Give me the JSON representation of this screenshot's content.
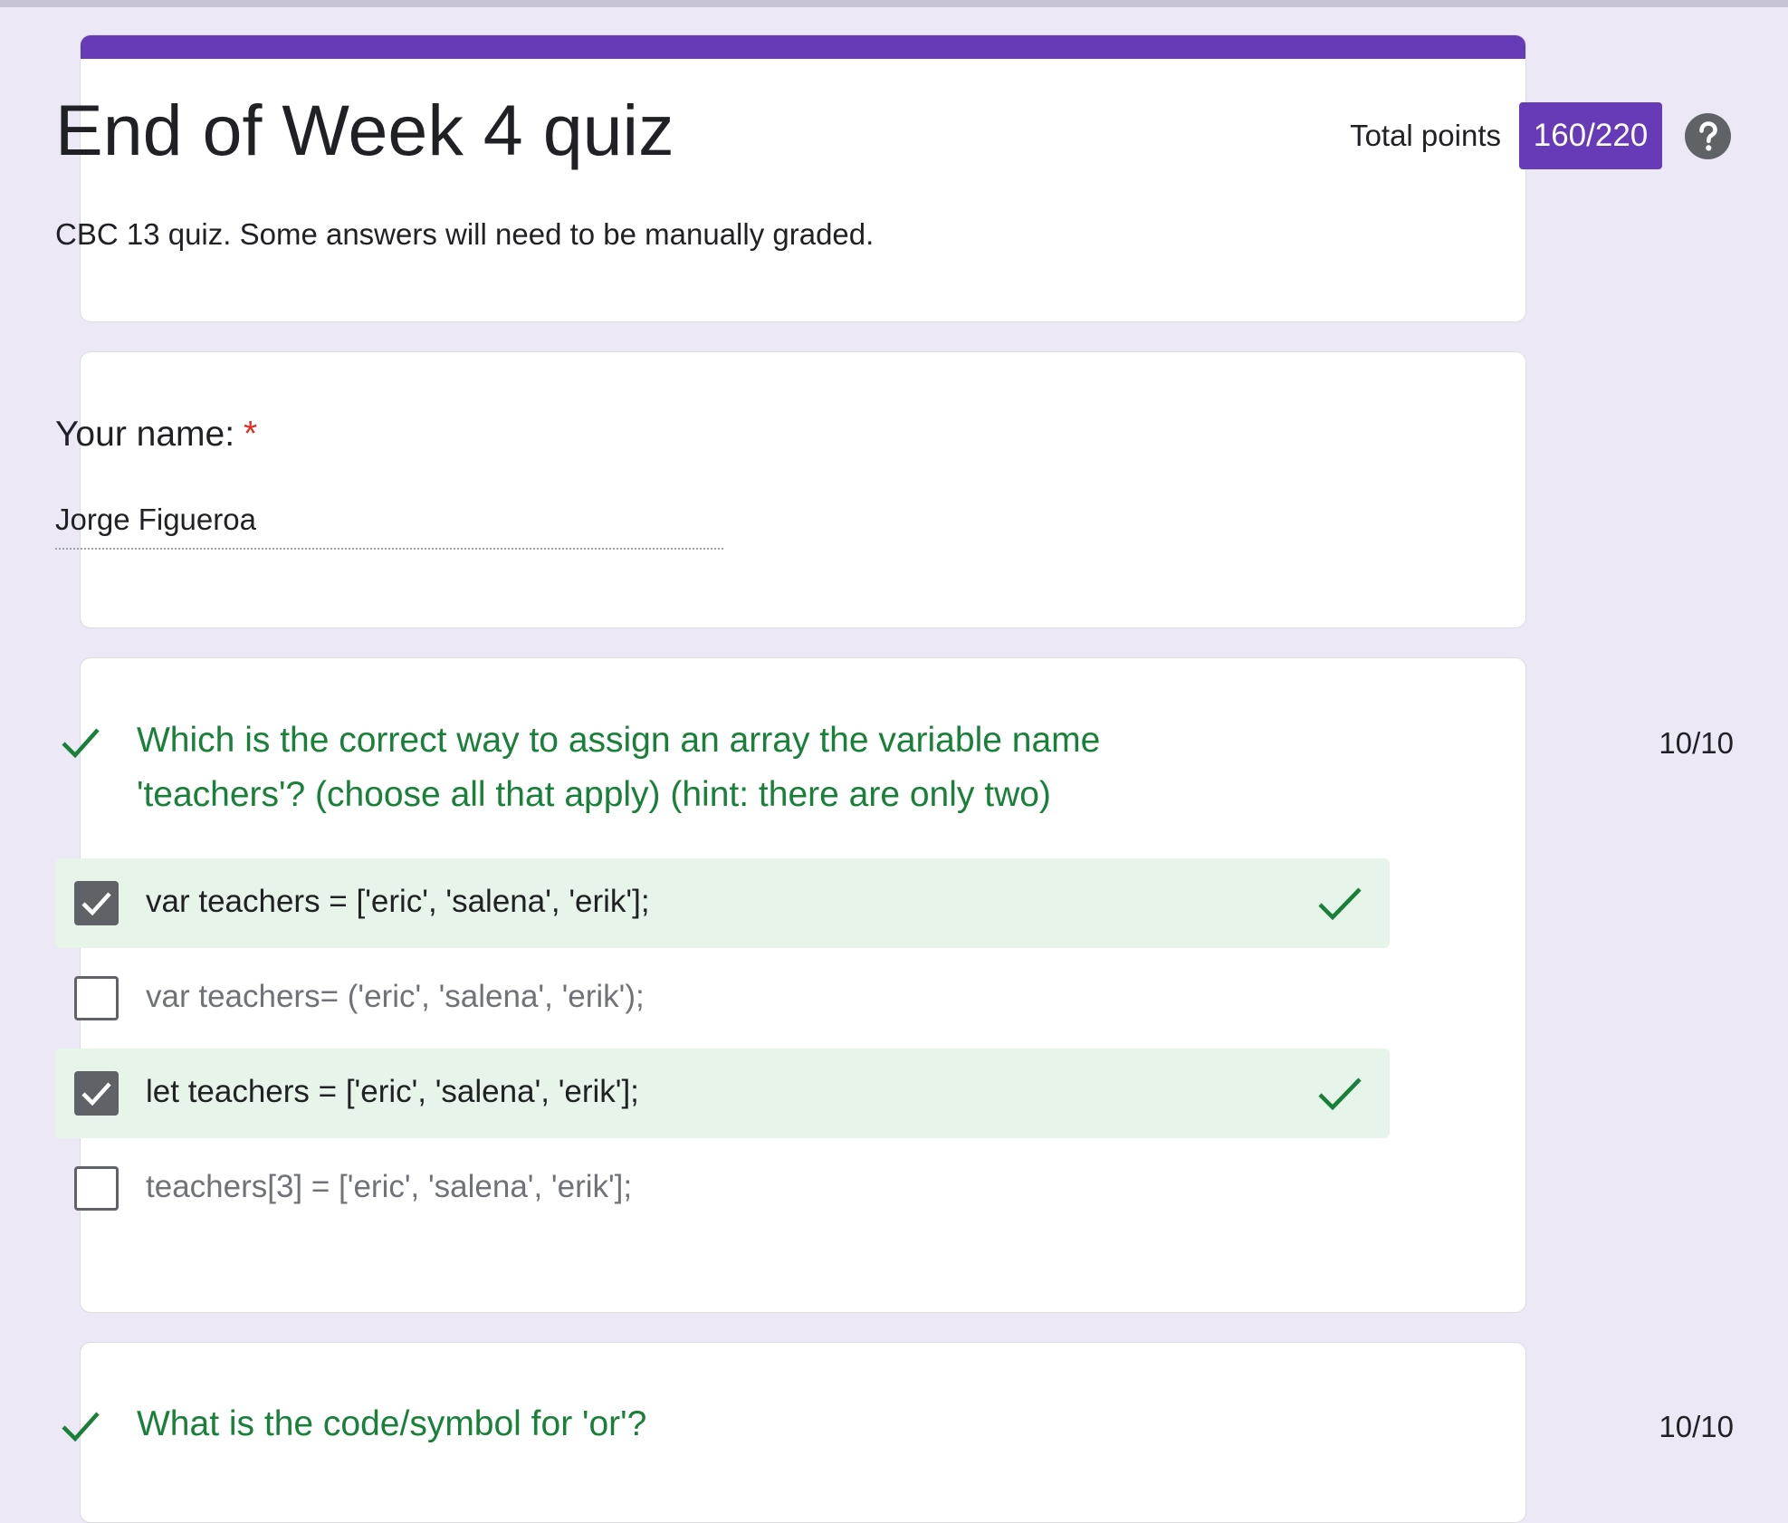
{
  "form": {
    "title": "End of Week 4 quiz",
    "description": "CBC 13 quiz. Some answers will need to be manually graded.",
    "total_points_label": "Total points",
    "total_points_value": "160/220",
    "help_icon": "question-mark-circle-icon",
    "accent_color": "#673ab7"
  },
  "name_question": {
    "label": "Your name:",
    "required_marker": "*",
    "answer": "Jorge Figueroa"
  },
  "questions": [
    {
      "text": "Which is the correct way to assign an array the variable name 'teachers'? (choose all that apply) (hint: there are only two)",
      "score": "10/10",
      "status_icon": "check-icon",
      "status_color": "#188038",
      "options": [
        {
          "label": "var teachers = ['eric', 'salena', 'erik'];",
          "checked": true,
          "correct": true
        },
        {
          "label": "var teachers= ('eric', 'salena', 'erik');",
          "checked": false,
          "correct": false
        },
        {
          "label": "let teachers = ['eric', 'salena', 'erik'];",
          "checked": true,
          "correct": true
        },
        {
          "label": "teachers[3] = ['eric', 'salena', 'erik'];",
          "checked": false,
          "correct": false
        }
      ]
    },
    {
      "text": "What is the code/symbol for 'or'?",
      "score": "10/10",
      "status_icon": "check-icon",
      "status_color": "#188038"
    }
  ]
}
